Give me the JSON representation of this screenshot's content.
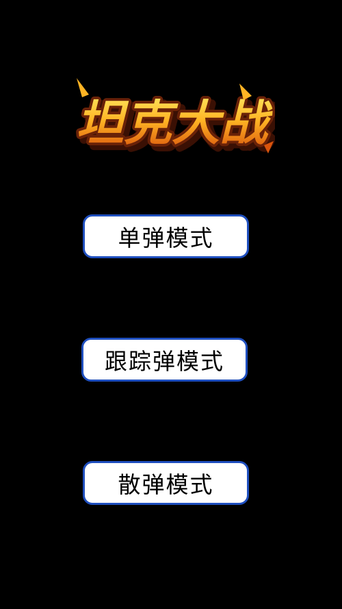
{
  "game": {
    "title": "坦克大战",
    "colors": {
      "background": "#000000",
      "button_fill": "#ffffff",
      "button_border": "#1f4fbf",
      "title_fill_top": "#ffd23a",
      "title_fill_bottom": "#e06a10",
      "title_outline": "#5a1a08"
    }
  },
  "menu": {
    "single_shot_label": "单弹模式",
    "homing_shot_label": "跟踪弹模式",
    "spread_shot_label": "散弹模式"
  }
}
